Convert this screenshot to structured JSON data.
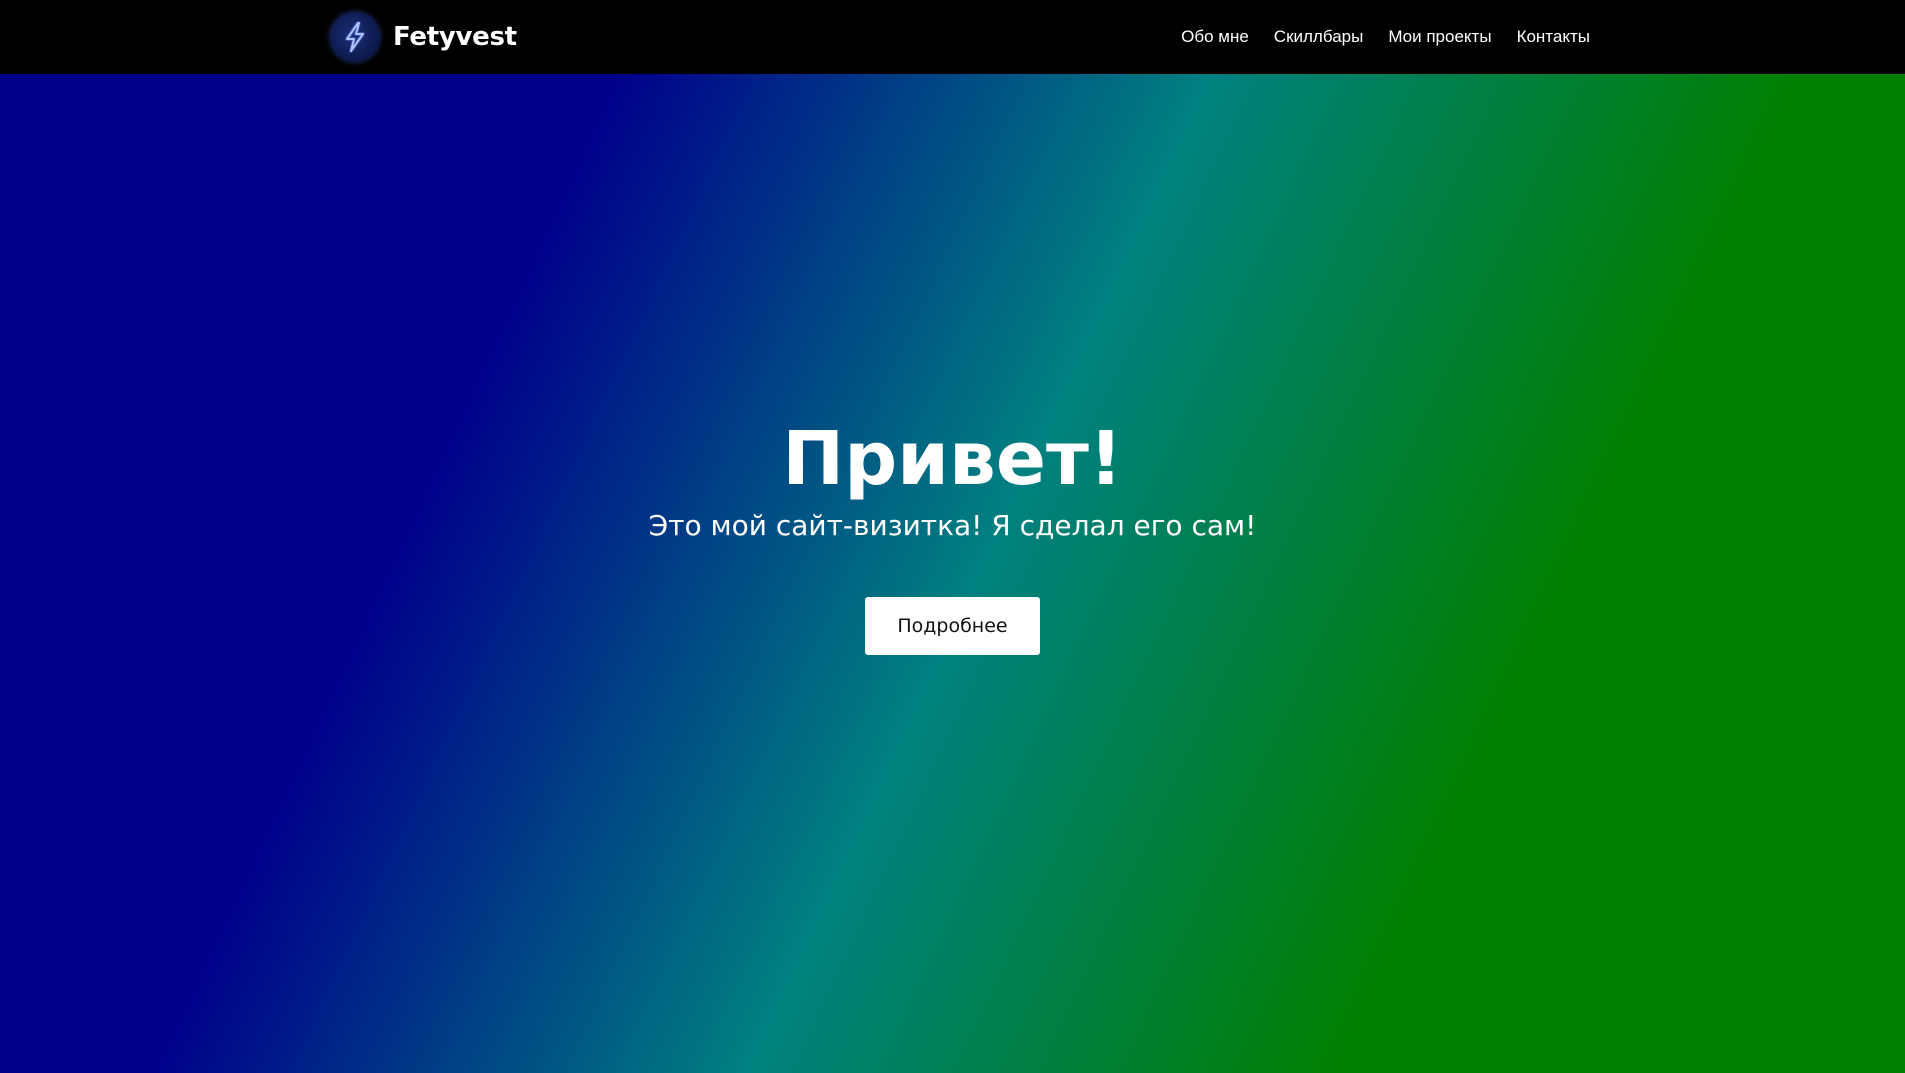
{
  "header": {
    "brand_name": "Fetyvest",
    "logo_icon": "lightning-bolt-icon",
    "nav": [
      {
        "label": "Обо мне"
      },
      {
        "label": "Скиллбары"
      },
      {
        "label": "Мои проекты"
      },
      {
        "label": "Контакты"
      }
    ]
  },
  "hero": {
    "title": "Привет!",
    "subtitle": "Это мой сайт-визитка! Я сделал его сам!",
    "button_label": "Подробнее"
  },
  "colors": {
    "navbar_bg": "#000000",
    "gradient_start": "#00008b",
    "gradient_mid": "#008080",
    "gradient_end": "#008000",
    "button_bg": "#ffffff"
  }
}
